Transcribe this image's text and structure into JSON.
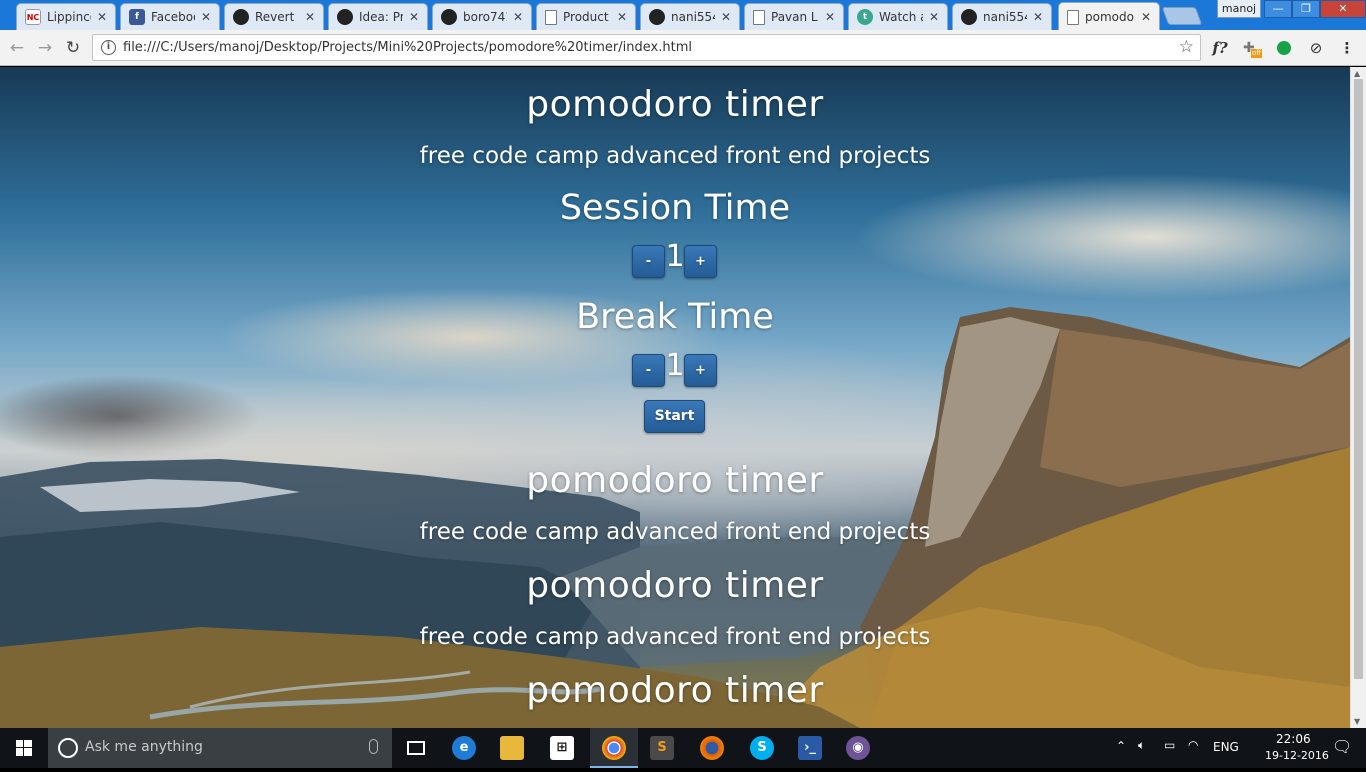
{
  "browser": {
    "tabs": [
      {
        "title": "Lippinco",
        "icon": "nc"
      },
      {
        "title": "Faceboo",
        "icon": "facebook"
      },
      {
        "title": "Revert \"r",
        "icon": "github"
      },
      {
        "title": "Idea: Pro",
        "icon": "github"
      },
      {
        "title": "boro741",
        "icon": "github"
      },
      {
        "title": "Product",
        "icon": "document"
      },
      {
        "title": "nani554",
        "icon": "github"
      },
      {
        "title": "Pavan L",
        "icon": "document"
      },
      {
        "title": "Watch a",
        "icon": "t"
      },
      {
        "title": "nani554",
        "icon": "github"
      },
      {
        "title": "pomodo",
        "icon": "document"
      }
    ],
    "user": "manoj",
    "url": "file:///C:/Users/manoj/Desktop/Projects/Mini%20Projects/pomodore%20timer/index.html",
    "ext_fx": "f?",
    "ext_off_badge": "off"
  },
  "page": {
    "title": "pomodoro timer",
    "subtitle": "free code camp advanced front end projects",
    "session_label": "Session Time",
    "session_value": "1",
    "break_label": "Break Time",
    "break_value": "1",
    "minus": "-",
    "plus": "+",
    "start": "Start",
    "repeats": [
      {
        "title": "pomodoro timer",
        "subtitle": "free code camp advanced front end projects"
      },
      {
        "title": "pomodoro timer",
        "subtitle": "free code camp advanced front end projects"
      },
      {
        "title": "pomodoro timer"
      }
    ]
  },
  "taskbar": {
    "search_placeholder": "Ask me anything",
    "lang": "ENG",
    "time": "22:06",
    "date": "19-12-2016"
  }
}
